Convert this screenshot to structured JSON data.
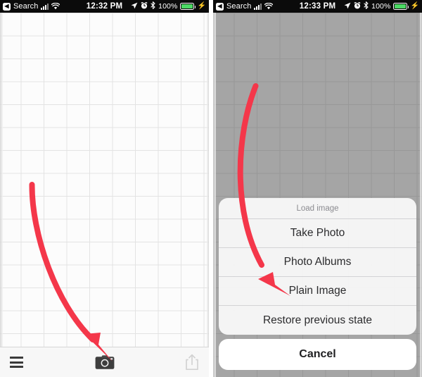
{
  "panels": [
    {
      "id": "left",
      "status_bar": {
        "back_chip": "◀",
        "carrier_label": "Search",
        "signal_icon": "signal-bars-icon",
        "wifi_icon": "wifi-icon",
        "time": "12:32 PM",
        "location_icon": "location-arrow-icon",
        "alarm_icon": "alarm-clock-icon",
        "bluetooth_icon": "bluetooth-icon",
        "battery_percent": "100%",
        "battery_icon": "battery-full-icon",
        "charging_icon": "⚡"
      },
      "toolbar": {
        "menu_label": "menu-icon",
        "camera_label": "camera-icon",
        "share_label": "share-icon"
      },
      "annotation": {
        "arrow_color": "#f4374a",
        "points_to": "camera-icon"
      }
    },
    {
      "id": "right",
      "status_bar": {
        "back_chip": "◀",
        "carrier_label": "Search",
        "signal_icon": "signal-bars-icon",
        "wifi_icon": "wifi-icon",
        "time": "12:33 PM",
        "location_icon": "location-arrow-icon",
        "alarm_icon": "alarm-clock-icon",
        "bluetooth_icon": "bluetooth-icon",
        "battery_percent": "100%",
        "battery_icon": "battery-full-icon",
        "charging_icon": "⚡"
      },
      "action_sheet": {
        "title": "Load image",
        "options": [
          "Take Photo",
          "Photo Albums",
          "Plain Image",
          "Restore previous state"
        ],
        "cancel_label": "Cancel"
      },
      "annotation": {
        "arrow_color": "#f4374a",
        "points_to": "Plain Image"
      }
    }
  ],
  "colors": {
    "status_bar_bg": "#0b0b0b",
    "battery_green": "#4cd964",
    "annotation_red": "#f4374a",
    "sheet_bg": "#f9f9f9",
    "grid_line": "#e3e3e3",
    "dim_overlay": "rgba(60,60,60,0.45)"
  }
}
